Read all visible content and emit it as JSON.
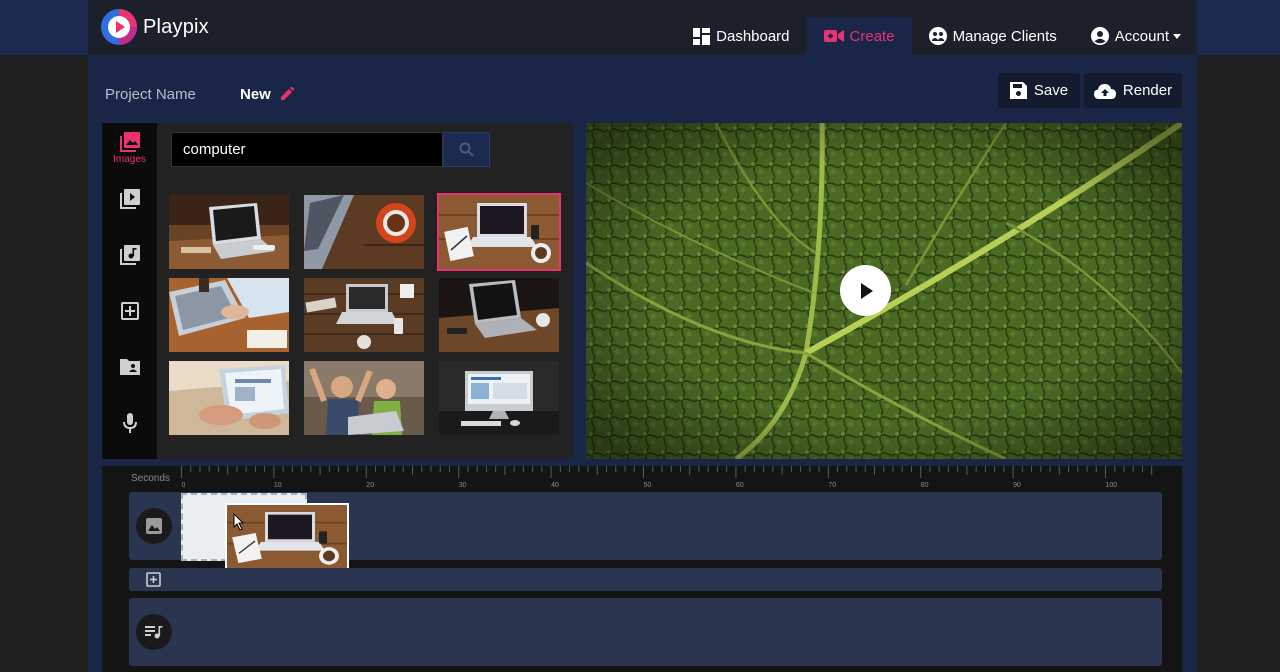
{
  "brand": {
    "name": "Playpix",
    "logo_icon": "playpix-play-logo-icon"
  },
  "nav": {
    "items": [
      {
        "label": "Dashboard",
        "icon": "dashboard-grid-icon",
        "active": false
      },
      {
        "label": "Create",
        "icon": "video-camera-icon",
        "active": true
      },
      {
        "label": "Manage Clients",
        "icon": "users-circle-icon",
        "active": false
      },
      {
        "label": "Account",
        "icon": "user-circle-icon",
        "active": false,
        "dropdown": true
      }
    ]
  },
  "project": {
    "label": "Project Name",
    "value": "New",
    "edit_icon": "pencil-icon"
  },
  "toolbar": {
    "save_label": "Save",
    "render_label": "Render",
    "save_icon": "floppy-disk-icon",
    "render_icon": "cloud-upload-icon"
  },
  "sidebar": {
    "items": [
      {
        "label": "Images",
        "icon": "images-icon",
        "active": true
      },
      {
        "label": "",
        "icon": "video-library-icon",
        "active": false
      },
      {
        "label": "",
        "icon": "music-library-icon",
        "active": false
      },
      {
        "label": "",
        "icon": "add-text-icon",
        "active": false
      },
      {
        "label": "",
        "icon": "user-folder-icon",
        "active": false
      },
      {
        "label": "",
        "icon": "microphone-icon",
        "active": false
      }
    ]
  },
  "search": {
    "value": "computer",
    "placeholder": "",
    "button_icon": "search-icon"
  },
  "gallery": {
    "selected_index": 2,
    "images": [
      "laptop-on-wood-desk",
      "laptop-keyboard-with-coffee-cup",
      "laptop-with-notebook-and-coffee",
      "hands-typing-on-laptop",
      "laptop-with-dream-sign",
      "laptop-on-dark-desk",
      "hands-on-tablet",
      "excited-kids-with-laptop",
      "desktop-computer-on-dark"
    ]
  },
  "preview": {
    "subject": "green-leaf-closeup",
    "play_icon": "play-icon"
  },
  "timeline": {
    "ruler_label": "Seconds",
    "ticks": [
      "0",
      "10",
      "20",
      "30",
      "40",
      "50",
      "60",
      "70",
      "80",
      "90",
      "100"
    ],
    "tracks": [
      {
        "icon": "image-track-icon"
      },
      {
        "icon": "text-track-icon"
      },
      {
        "icon": "music-track-icon"
      }
    ],
    "drag_clip": "laptop-with-notebook-and-coffee"
  },
  "colors": {
    "accent": "#e8336f",
    "navbar": "#1c202b",
    "app_bg": "#1a2647",
    "panel": "#222222",
    "track": "#2a3550"
  }
}
